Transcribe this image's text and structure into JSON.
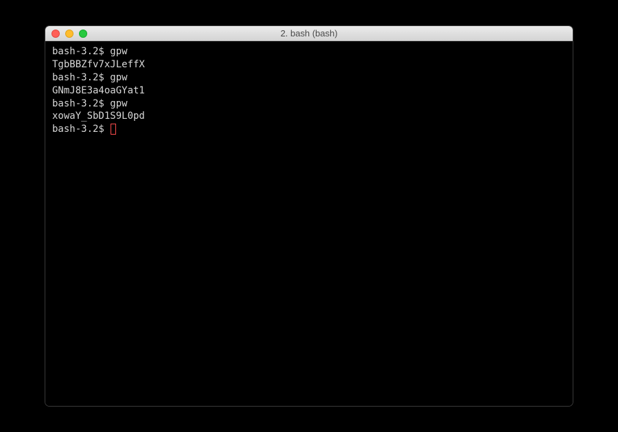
{
  "window": {
    "title": "2. bash (bash)"
  },
  "terminal": {
    "prompt": "bash-3.2$ ",
    "lines": [
      {
        "type": "cmd",
        "text": "gpw"
      },
      {
        "type": "out",
        "text": "TgbBBZfv7xJLeffX"
      },
      {
        "type": "cmd",
        "text": "gpw"
      },
      {
        "type": "out",
        "text": "GNmJ8E3a4oaGYat1"
      },
      {
        "type": "cmd",
        "text": "gpw"
      },
      {
        "type": "out",
        "text": "xowaY_SbD1S9L0pd"
      }
    ]
  }
}
